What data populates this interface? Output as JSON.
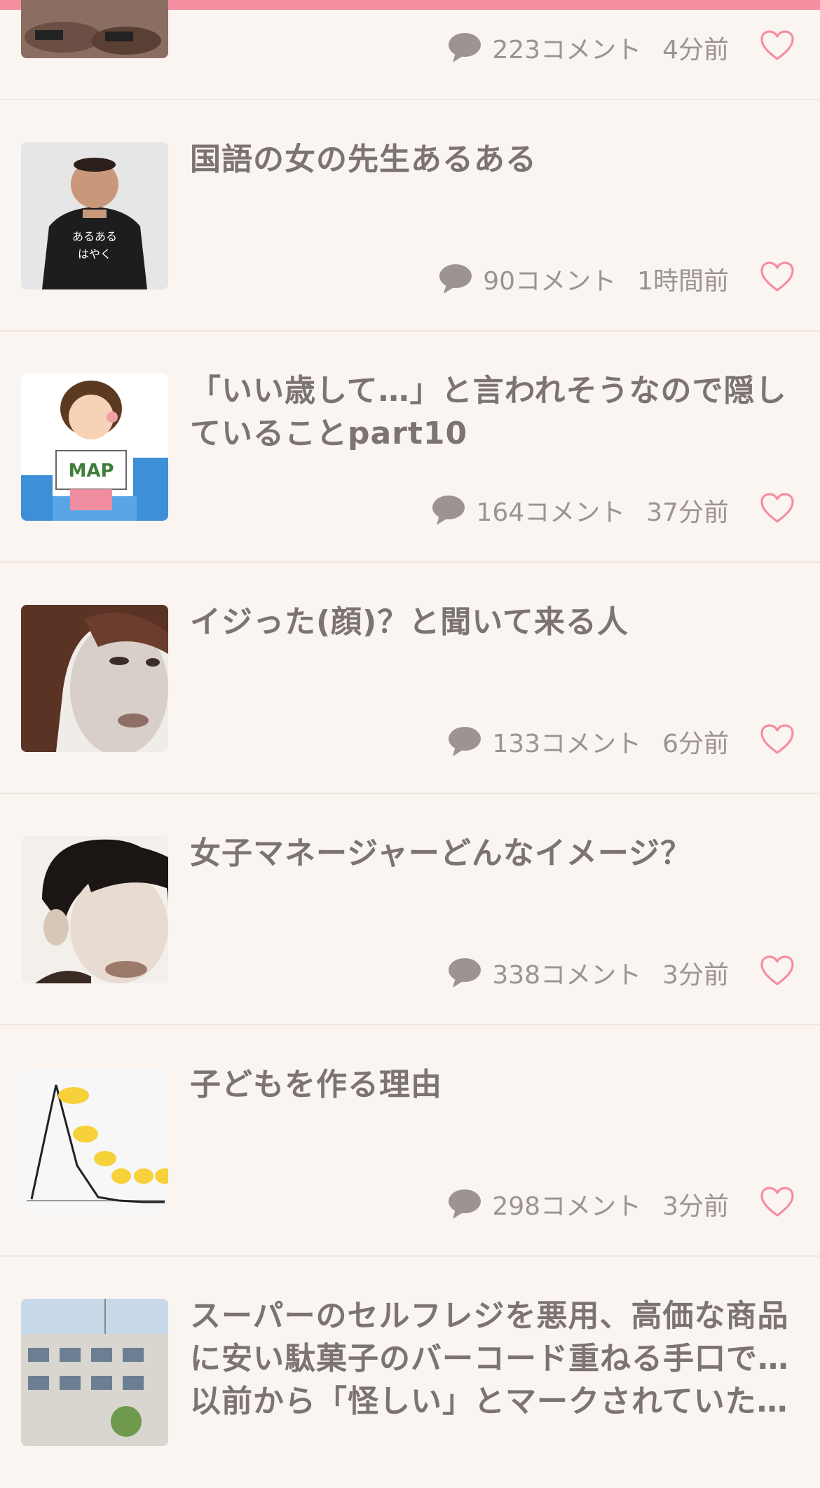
{
  "icons": {
    "comment": "comment-bubble-icon",
    "favorite": "heart-outline-icon"
  },
  "colors": {
    "accent": "#f58ea0",
    "background": "#fbf5f1",
    "title": "#7b7471",
    "meta": "#9b9491"
  },
  "items": [
    {
      "title": "",
      "comments": "223コメント",
      "time": "4分前",
      "thumb": "photo-partial"
    },
    {
      "title": "国語の女の先生あるある",
      "comments": "90コメント",
      "time": "1時間前",
      "thumb": "man-tshirt"
    },
    {
      "title": "「いい歳して…」と言われそうなので隠していることpart10",
      "comments": "164コメント",
      "time": "37分前",
      "thumb": "girl-map-illustration",
      "thumb_text": "MAP"
    },
    {
      "title": "イジった(顔)？と聞いて来る人",
      "comments": "133コメント",
      "time": "6分前",
      "thumb": "woman-face-painting"
    },
    {
      "title": "女子マネージャーどんなイメージ？",
      "comments": "338コメント",
      "time": "3分前",
      "thumb": "girl-face-illustration"
    },
    {
      "title": "子どもを作る理由",
      "comments": "298コメント",
      "time": "3分前",
      "thumb": "line-chart-image"
    },
    {
      "title": "スーパーのセルフレジを悪用、高価な商品に安い駄菓子のバーコード重ねる手口で…以前から「怪しい」とマークされていた…",
      "comments": "",
      "time": "",
      "thumb": "building-photo"
    }
  ]
}
